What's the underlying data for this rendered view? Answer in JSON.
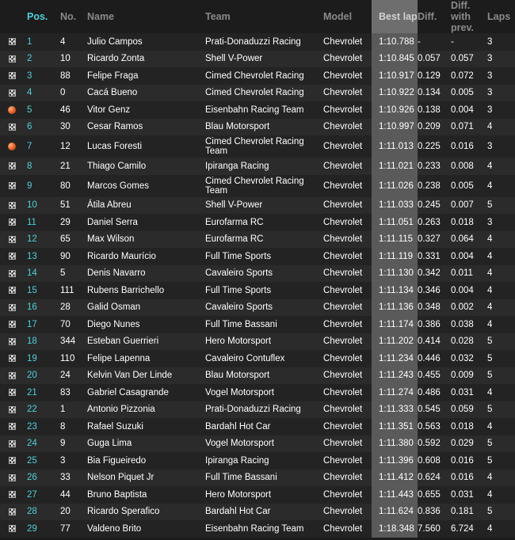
{
  "headers": {
    "pos": "Pos.",
    "no": "No.",
    "name": "Name",
    "team": "Team",
    "model": "Model",
    "best_lap": "Best lap",
    "diff": "Diff.",
    "diff_prev": "Diff. with prev.",
    "laps": "Laps"
  },
  "rows": [
    {
      "icon": "checkered-flag",
      "pos": "1",
      "no": "4",
      "name": "Julio Campos",
      "team": "Prati-Donaduzzi Racing",
      "model": "Chevrolet",
      "best": "1:10.788",
      "diff": "-",
      "diffprev": "-",
      "laps": "3"
    },
    {
      "icon": "checkered-flag",
      "pos": "2",
      "no": "10",
      "name": "Ricardo Zonta",
      "team": "Shell V-Power",
      "model": "Chevrolet",
      "best": "1:10.845",
      "diff": "0.057",
      "diffprev": "0.057",
      "laps": "3"
    },
    {
      "icon": "checkered-flag",
      "pos": "3",
      "no": "88",
      "name": "Felipe Fraga",
      "team": "Cimed Chevrolet Racing",
      "model": "Chevrolet",
      "best": "1:10.917",
      "diff": "0.129",
      "diffprev": "0.072",
      "laps": "3"
    },
    {
      "icon": "checkered-flag",
      "pos": "4",
      "no": "0",
      "name": "Cacá Bueno",
      "team": "Cimed Chevrolet Racing",
      "model": "Chevrolet",
      "best": "1:10.922",
      "diff": "0.134",
      "diffprev": "0.005",
      "laps": "3"
    },
    {
      "icon": "pit-dot",
      "pos": "5",
      "no": "46",
      "name": "Vitor Genz",
      "team": "Eisenbahn Racing Team",
      "model": "Chevrolet",
      "best": "1:10.926",
      "diff": "0.138",
      "diffprev": "0.004",
      "laps": "3"
    },
    {
      "icon": "checkered-flag",
      "pos": "6",
      "no": "30",
      "name": "Cesar Ramos",
      "team": "Blau Motorsport",
      "model": "Chevrolet",
      "best": "1:10.997",
      "diff": "0.209",
      "diffprev": "0.071",
      "laps": "4"
    },
    {
      "icon": "pit-dot",
      "pos": "7",
      "no": "12",
      "name": "Lucas Foresti",
      "team": "Cimed Chevrolet Racing Team",
      "model": "Chevrolet",
      "best": "1:11.013",
      "diff": "0.225",
      "diffprev": "0.016",
      "laps": "3",
      "tall": true
    },
    {
      "icon": "checkered-flag",
      "pos": "8",
      "no": "21",
      "name": "Thiago Camilo",
      "team": "Ipiranga Racing",
      "model": "Chevrolet",
      "best": "1:11.021",
      "diff": "0.233",
      "diffprev": "0.008",
      "laps": "4"
    },
    {
      "icon": "checkered-flag",
      "pos": "9",
      "no": "80",
      "name": "Marcos Gomes",
      "team": "Cimed Chevrolet Racing Team",
      "model": "Chevrolet",
      "best": "1:11.026",
      "diff": "0.238",
      "diffprev": "0.005",
      "laps": "4",
      "tall": true
    },
    {
      "icon": "checkered-flag",
      "pos": "10",
      "no": "51",
      "name": "Átila Abreu",
      "team": "Shell V-Power",
      "model": "Chevrolet",
      "best": "1:11.033",
      "diff": "0.245",
      "diffprev": "0.007",
      "laps": "5"
    },
    {
      "icon": "checkered-flag",
      "pos": "11",
      "no": "29",
      "name": "Daniel Serra",
      "team": "Eurofarma RC",
      "model": "Chevrolet",
      "best": "1:11.051",
      "diff": "0.263",
      "diffprev": "0.018",
      "laps": "3"
    },
    {
      "icon": "checkered-flag",
      "pos": "12",
      "no": "65",
      "name": "Max Wilson",
      "team": "Eurofarma RC",
      "model": "Chevrolet",
      "best": "1:11.115",
      "diff": "0.327",
      "diffprev": "0.064",
      "laps": "4"
    },
    {
      "icon": "checkered-flag",
      "pos": "13",
      "no": "90",
      "name": "Ricardo Maurício",
      "team": "Full Time Sports",
      "model": "Chevrolet",
      "best": "1:11.119",
      "diff": "0.331",
      "diffprev": "0.004",
      "laps": "4"
    },
    {
      "icon": "checkered-flag",
      "pos": "14",
      "no": "5",
      "name": "Denis Navarro",
      "team": "Cavaleiro Sports",
      "model": "Chevrolet",
      "best": "1:11.130",
      "diff": "0.342",
      "diffprev": "0.011",
      "laps": "4"
    },
    {
      "icon": "checkered-flag",
      "pos": "15",
      "no": "111",
      "name": "Rubens Barrichello",
      "team": "Full Time Sports",
      "model": "Chevrolet",
      "best": "1:11.134",
      "diff": "0.346",
      "diffprev": "0.004",
      "laps": "4"
    },
    {
      "icon": "checkered-flag",
      "pos": "16",
      "no": "28",
      "name": "Galid Osman",
      "team": "Cavaleiro Sports",
      "model": "Chevrolet",
      "best": "1:11.136",
      "diff": "0.348",
      "diffprev": "0.002",
      "laps": "4"
    },
    {
      "icon": "checkered-flag",
      "pos": "17",
      "no": "70",
      "name": "Diego Nunes",
      "team": "Full Time Bassani",
      "model": "Chevrolet",
      "best": "1:11.174",
      "diff": "0.386",
      "diffprev": "0.038",
      "laps": "4"
    },
    {
      "icon": "checkered-flag",
      "pos": "18",
      "no": "344",
      "name": "Esteban Guerrieri",
      "team": "Hero Motorsport",
      "model": "Chevrolet",
      "best": "1:11.202",
      "diff": "0.414",
      "diffprev": "0.028",
      "laps": "5"
    },
    {
      "icon": "checkered-flag",
      "pos": "19",
      "no": "110",
      "name": "Felipe Lapenna",
      "team": "Cavaleiro Contuflex",
      "model": "Chevrolet",
      "best": "1:11.234",
      "diff": "0.446",
      "diffprev": "0.032",
      "laps": "5"
    },
    {
      "icon": "checkered-flag",
      "pos": "20",
      "no": "24",
      "name": "Kelvin Van Der Linde",
      "team": "Blau Motorsport",
      "model": "Chevrolet",
      "best": "1:11.243",
      "diff": "0.455",
      "diffprev": "0.009",
      "laps": "5"
    },
    {
      "icon": "checkered-flag",
      "pos": "21",
      "no": "83",
      "name": "Gabriel Casagrande",
      "team": "Vogel Motorsport",
      "model": "Chevrolet",
      "best": "1:11.274",
      "diff": "0.486",
      "diffprev": "0.031",
      "laps": "4"
    },
    {
      "icon": "checkered-flag",
      "pos": "22",
      "no": "1",
      "name": "Antonio Pizzonia",
      "team": "Prati-Donaduzzi Racing",
      "model": "Chevrolet",
      "best": "1:11.333",
      "diff": "0.545",
      "diffprev": "0.059",
      "laps": "5"
    },
    {
      "icon": "checkered-flag",
      "pos": "23",
      "no": "8",
      "name": "Rafael Suzuki",
      "team": "Bardahl Hot Car",
      "model": "Chevrolet",
      "best": "1:11.351",
      "diff": "0.563",
      "diffprev": "0.018",
      "laps": "4"
    },
    {
      "icon": "checkered-flag",
      "pos": "24",
      "no": "9",
      "name": "Guga Lima",
      "team": "Vogel Motorsport",
      "model": "Chevrolet",
      "best": "1:11.380",
      "diff": "0.592",
      "diffprev": "0.029",
      "laps": "5"
    },
    {
      "icon": "checkered-flag",
      "pos": "25",
      "no": "3",
      "name": "Bia Figueiredo",
      "team": "Ipiranga Racing",
      "model": "Chevrolet",
      "best": "1:11.396",
      "diff": "0.608",
      "diffprev": "0.016",
      "laps": "5"
    },
    {
      "icon": "checkered-flag",
      "pos": "26",
      "no": "33",
      "name": "Nelson Piquet Jr",
      "team": "Full Time Bassani",
      "model": "Chevrolet",
      "best": "1:11.412",
      "diff": "0.624",
      "diffprev": "0.016",
      "laps": "4"
    },
    {
      "icon": "checkered-flag",
      "pos": "27",
      "no": "44",
      "name": "Bruno Baptista",
      "team": "Hero Motorsport",
      "model": "Chevrolet",
      "best": "1:11.443",
      "diff": "0.655",
      "diffprev": "0.031",
      "laps": "4"
    },
    {
      "icon": "checkered-flag",
      "pos": "28",
      "no": "20",
      "name": "Ricardo Sperafico",
      "team": "Bardahl Hot Car",
      "model": "Chevrolet",
      "best": "1:11.624",
      "diff": "0.836",
      "diffprev": "0.181",
      "laps": "5"
    },
    {
      "icon": "checkered-flag",
      "pos": "29",
      "no": "77",
      "name": "Valdeno Brito",
      "team": "Eisenbahn Racing Team",
      "model": "Chevrolet",
      "best": "1:18.348",
      "diff": "7.560",
      "diffprev": "6.724",
      "laps": "4"
    }
  ],
  "colors": {
    "background": "#1c1c1c",
    "position_accent": "#4fd0d6",
    "best_lap_column": "#5a5a5a",
    "pit_dot": "#e0541a"
  }
}
